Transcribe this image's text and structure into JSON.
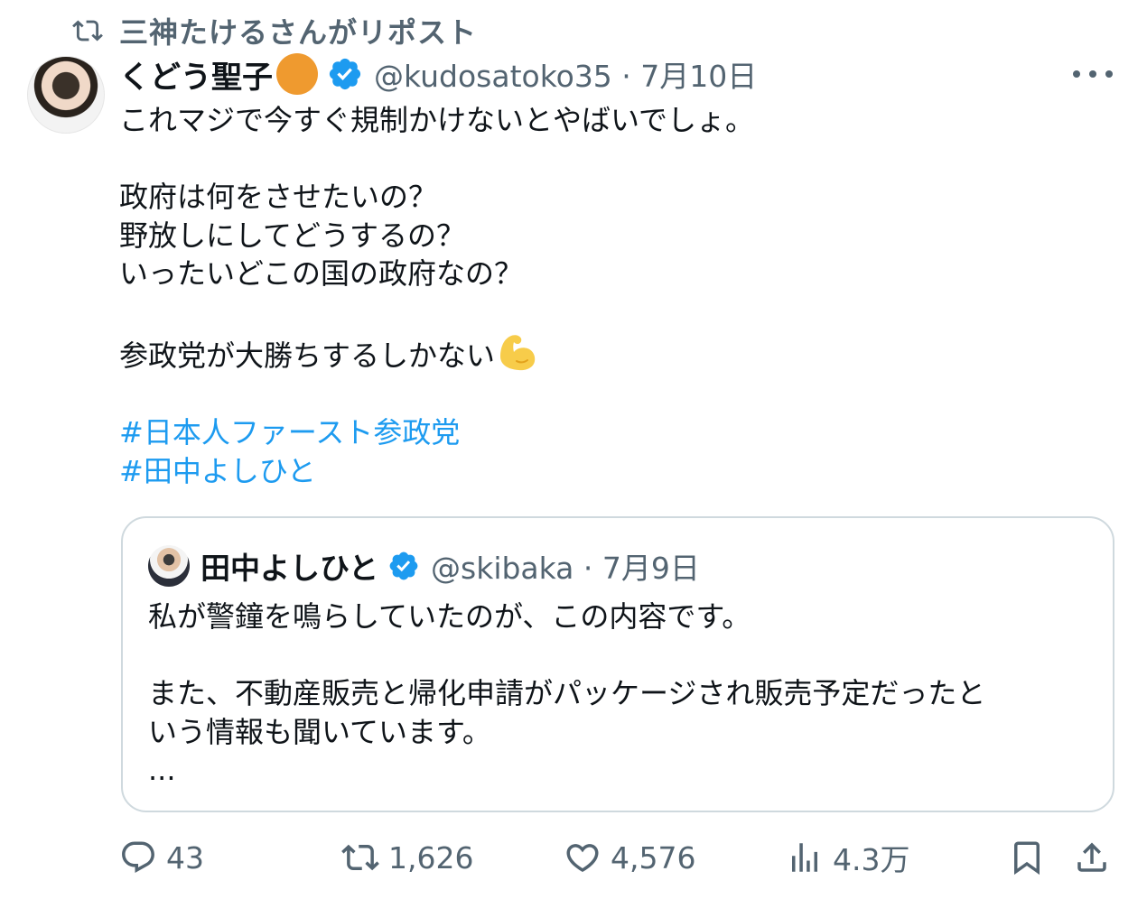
{
  "repost": {
    "text": "三神たけるさんがリポスト"
  },
  "post": {
    "author_name": "くどう聖子",
    "handle_date": "@kudosatoko35 · 7月10日",
    "lines": [
      "これマジで今すぐ規制かけないとやばいでしょ。",
      "",
      "政府は何をさせたいの？",
      "野放しにしてどうするの？",
      "いったいどこの国の政府なの？",
      "",
      "参政党が大勝ちするしかない"
    ],
    "emoji": "flexed-biceps",
    "hashtags": [
      "#日本人ファースト参政党",
      "#田中よしひと"
    ]
  },
  "quote": {
    "author_name": "田中よしひと",
    "handle_date": "@skibaka · 7月9日",
    "lines": [
      "私が警鐘を鳴らしていたのが、この内容です。",
      "",
      "また、不動産販売と帰化申請がパッケージされ販売予定だったと",
      "いう情報も聞いています。",
      "..."
    ]
  },
  "actions": {
    "replies": "43",
    "reposts": "1,626",
    "likes": "4,576",
    "views": "4.3万"
  },
  "colors": {
    "accent": "#1d9bf0",
    "muted": "#536471",
    "text": "#0f1419",
    "border": "#cfd9de"
  },
  "icons": [
    "repost-icon",
    "verified-icon",
    "more-icon",
    "reply-icon",
    "like-icon",
    "views-icon",
    "bookmark-icon",
    "share-icon"
  ]
}
